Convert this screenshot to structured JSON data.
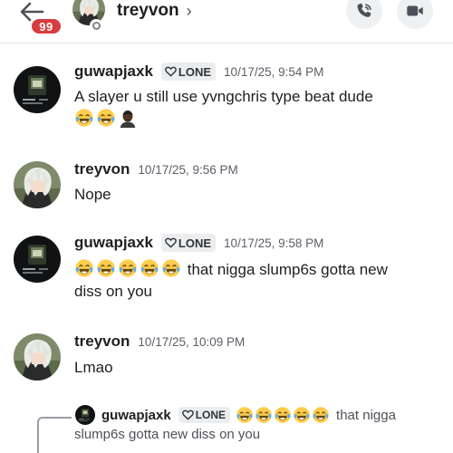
{
  "header": {
    "unread_count": "99",
    "name": "treyvon",
    "chevron": "›"
  },
  "messages": [
    {
      "username": "guwapjaxk",
      "tag": "LONE",
      "timestamp": "10/17/25, 9:54 PM",
      "text": "A slayer u still use yvngchris type beat dude",
      "emojis": [
        "joy-emoji",
        "joy-emoji",
        "man-shrugging-emoji"
      ]
    },
    {
      "username": "treyvon",
      "timestamp": "10/17/25, 9:56 PM",
      "text": "Nope"
    },
    {
      "username": "guwapjaxk",
      "tag": "LONE",
      "timestamp": "10/17/25, 9:58 PM",
      "text_after_emojis": "that nigga slump6s gotta new",
      "text_line2": "diss on you",
      "emojis": [
        "joy-emoji",
        "joy-emoji",
        "joy-emoji",
        "joy-emoji",
        "joy-emoji"
      ]
    },
    {
      "username": "treyvon",
      "timestamp": "10/17/25, 10:09 PM",
      "text": "Lmao"
    }
  ],
  "reply": {
    "username": "guwapjaxk",
    "tag": "LONE",
    "text_inline": "that nigga",
    "text_line2": "slump6s gotta new diss on you",
    "emojis": [
      "joy-emoji",
      "joy-emoji",
      "joy-emoji",
      "joy-emoji",
      "joy-emoji"
    ]
  },
  "colors": {
    "badge": "#d83c3e",
    "tag_bg": "#ebedef",
    "timestamp": "#5c5e66",
    "divider": "#e4e5e8"
  }
}
